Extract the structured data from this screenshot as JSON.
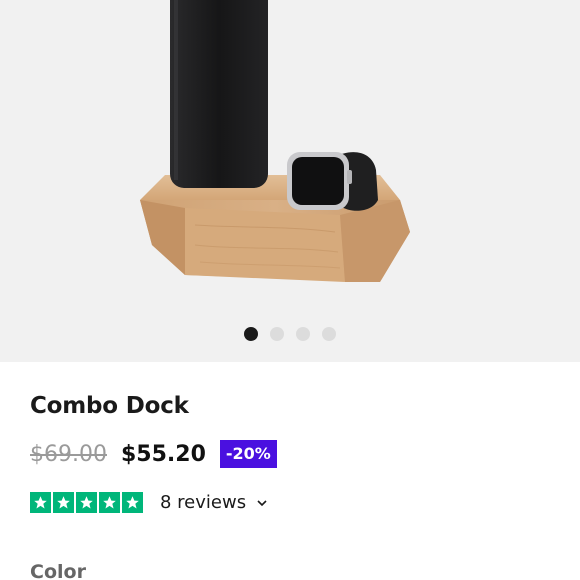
{
  "gallery": {
    "image_alt": "Wooden combo dock holding a phone and a smartwatch",
    "dots": [
      {
        "active": true
      },
      {
        "active": false
      },
      {
        "active": false
      },
      {
        "active": false
      }
    ]
  },
  "product": {
    "title": "Combo Dock",
    "original_price": "$69.00",
    "sale_price": "$55.20",
    "discount_badge": "-20%",
    "rating_stars": 5,
    "reviews_label": "8 reviews",
    "option_label": "Color"
  },
  "colors": {
    "badge_bg": "#4a10e0",
    "trustpilot_green": "#00b67a",
    "gallery_bg": "#f1f1f1"
  }
}
